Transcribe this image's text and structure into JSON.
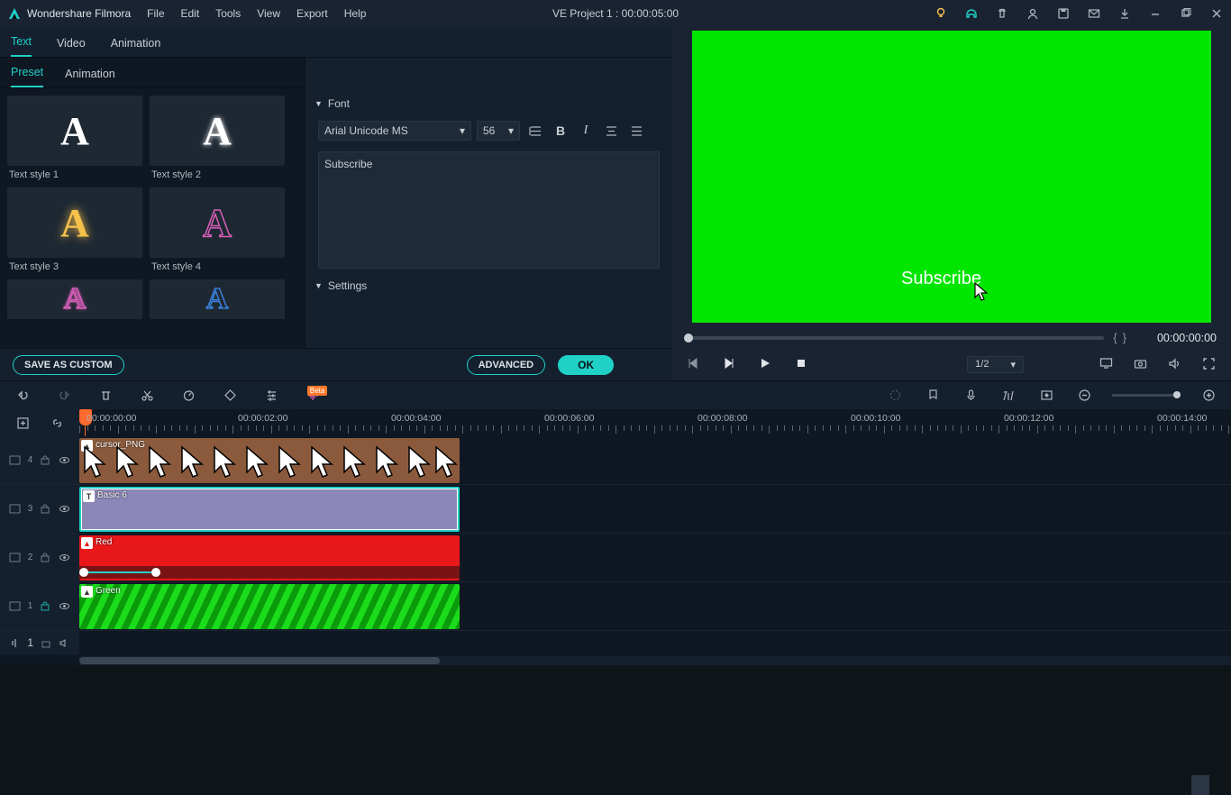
{
  "app": {
    "title": "Wondershare Filmora"
  },
  "menu": {
    "file": "File",
    "edit": "Edit",
    "tools": "Tools",
    "view": "View",
    "export": "Export",
    "help": "Help"
  },
  "project_title": "VE Project 1 : 00:00:05:00",
  "subtabs": {
    "text": "Text",
    "video": "Video",
    "animation": "Animation"
  },
  "subtabs2": {
    "preset": "Preset",
    "animation": "Animation"
  },
  "presets": {
    "s1": "Text style 1",
    "s2": "Text style 2",
    "s3": "Text style 3",
    "s4": "Text style 4"
  },
  "font": {
    "section": "Font",
    "family": "Arial Unicode MS",
    "size": "56",
    "text_value": "Subscribe"
  },
  "settings_section": "Settings",
  "buttons": {
    "save_custom": "SAVE AS CUSTOM",
    "advanced": "ADVANCED",
    "ok": "OK"
  },
  "preview": {
    "text": "Subscribe"
  },
  "progress": {
    "timecode": "00:00:00:00"
  },
  "player": {
    "ratio": "1/2"
  },
  "ruler": {
    "labels": [
      "00:00:00:00",
      "00:00:02:00",
      "00:00:04:00",
      "00:00:06:00",
      "00:00:08:00",
      "00:00:10:00",
      "00:00:12:00",
      "00:00:14:00"
    ]
  },
  "tracks": {
    "t4": {
      "name": "4",
      "clip": "cursor_PNG"
    },
    "t3": {
      "name": "3",
      "clip": "Basic 6"
    },
    "t2": {
      "name": "2",
      "clip": "Red"
    },
    "t1": {
      "name": "1",
      "clip": "Green"
    },
    "a1": {
      "name": "1"
    }
  },
  "beta": "Beta"
}
